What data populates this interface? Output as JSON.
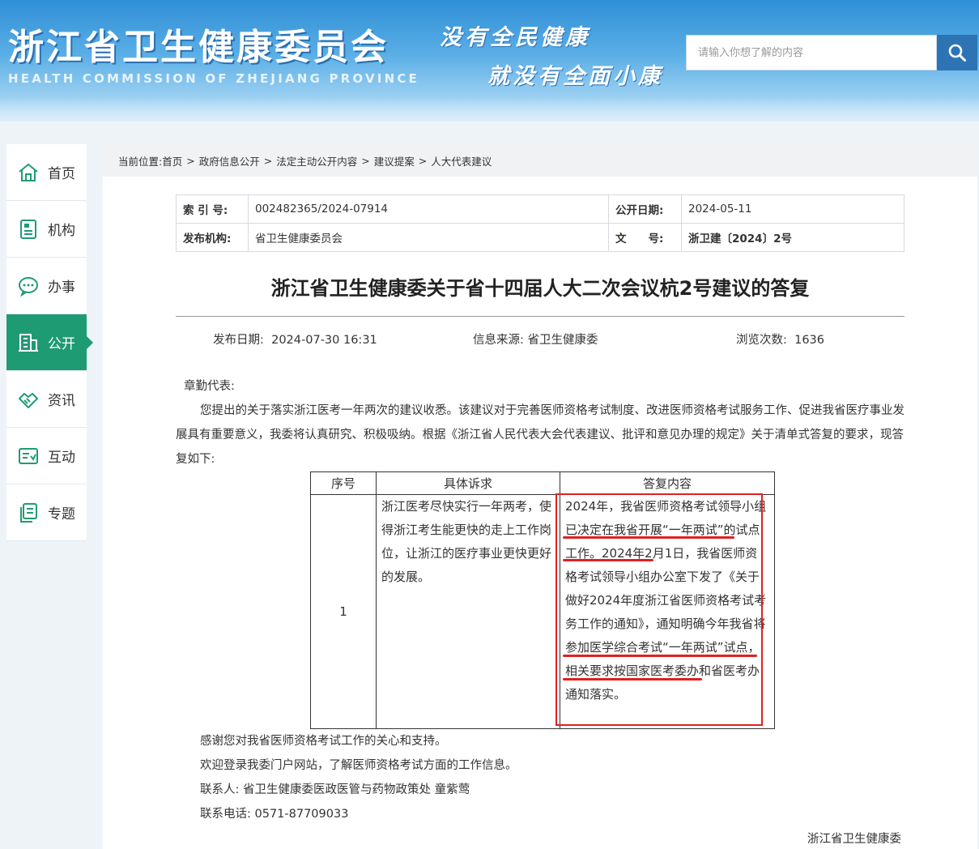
{
  "header": {
    "title": "浙江省卫生健康委员会",
    "subtitle": "HEALTH COMMISSION OF ZHEJIANG PROVINCE",
    "slogan_line1": "没有全民健康",
    "slogan_line2": "就没有全面小康",
    "search_placeholder": "请输入你想了解的内容"
  },
  "sidebar": {
    "items": [
      {
        "label": "首页",
        "icon": "home-icon"
      },
      {
        "label": "机构",
        "icon": "org-document-icon"
      },
      {
        "label": "办事",
        "icon": "chat-bubble-icon"
      },
      {
        "label": "公开",
        "icon": "building-icon",
        "active": true
      },
      {
        "label": "资讯",
        "icon": "handshake-icon"
      },
      {
        "label": "互动",
        "icon": "interaction-icon"
      },
      {
        "label": "专题",
        "icon": "topic-stack-icon"
      }
    ],
    "active_color": "#1f9b74"
  },
  "breadcrumb": {
    "prefix": "当前位置:",
    "items": [
      "首页",
      "政府信息公开",
      "法定主动公开内容",
      "建议提案",
      "人大代表建议"
    ],
    "sep": ">"
  },
  "meta": {
    "index_label": "索 引 号:",
    "index_value": "002482365/2024-07914",
    "pubdate_label": "公开日期:",
    "pubdate_value": "2024-05-11",
    "org_label": "发布机构:",
    "org_value": "省卫生健康委员会",
    "docno_label": "文　　号:",
    "docno_value": "浙卫建〔2024〕2号"
  },
  "article": {
    "title": "浙江省卫生健康委关于省十四届人大二次会议杭2号建议的答复",
    "publish_label": "发布日期:",
    "publish_value": "2024-07-30 16:31",
    "source_label": "信息来源:",
    "source_value": "省卫生健康委",
    "views_label": "浏览次数:",
    "views_value": "1636",
    "salutation": "章勤代表:",
    "intro": "您提出的关于落实浙江医考一年两次的建议收悉。该建议对于完善医师资格考试制度、改进医师资格考试服务工作、促进我省医疗事业发展具有重要意义，我委将认真研究、积极吸纳。根据《浙江省人民代表大会代表建议、批评和意见办理的规定》关于清单式答复的要求，现答复如下:",
    "table": {
      "headers": [
        "序号",
        "具体诉求",
        "答复内容"
      ],
      "rows": [
        {
          "num": "1",
          "demand": "浙江医考尽快实行一年两考，使得浙江考生能更快的走上工作岗位，让浙江的医疗事业更快更好的发展。",
          "reply": "2024年，我省医师资格考试领导小组已决定在我省开展“一年两试”的试点工作。2024年2月1日，我省医师资格考试领导小组办公室下发了《关于做好2024年度浙江省医师资格考试考务工作的通知》，通知明确今年我省将参加医学综合考试“一年两试”试点，相关要求按国家医考委办和省医考办通知落实。"
        }
      ]
    },
    "closing1": "感谢您对我省医师资格考试工作的关心和支持。",
    "closing2": "欢迎登录我委门户网站，了解医师资格考试方面的工作信息。",
    "contact_label": "联系人:",
    "contact_value": "省卫生健康委医政医管与药物政策处  童紫莺",
    "phone_label": "联系电话:",
    "phone_value": "0571-87709033",
    "signature": "浙江省卫生健康委"
  },
  "colors": {
    "header_blue": "#2f8fd6",
    "search_button": "#2e74b5",
    "highlight_red": "#e02020"
  }
}
